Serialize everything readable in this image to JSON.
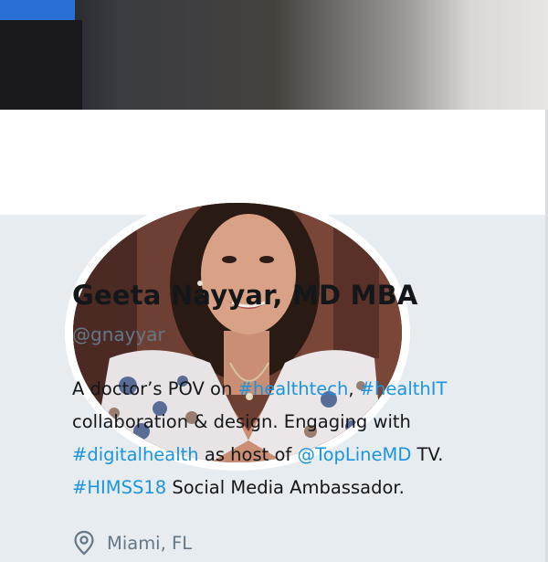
{
  "profile": {
    "name": "Geeta Nayyar, MD MBA",
    "handle": "@gnayyar",
    "bio": {
      "line1": {
        "t1": "A doctor’s POV on ",
        "link1": "#healthtech",
        "t2": ", ",
        "link2": "#healthIT"
      },
      "line2": {
        "t1": "collaboration & design. Engaging with"
      },
      "line3": {
        "link1": "#digitalhealth",
        "t1": " as host of ",
        "link2": "@TopLineMD",
        "t2": " TV."
      },
      "line4": {
        "link1": "#HIMSS18",
        "t1": " Social Media Ambassador."
      }
    },
    "location": "Miami, FL"
  },
  "icons": {
    "location": "location-pin-icon"
  },
  "colors": {
    "link": "#1b95e0",
    "name": "#14171a",
    "secondary": "#657786",
    "card_background": "#e6ecf0"
  }
}
